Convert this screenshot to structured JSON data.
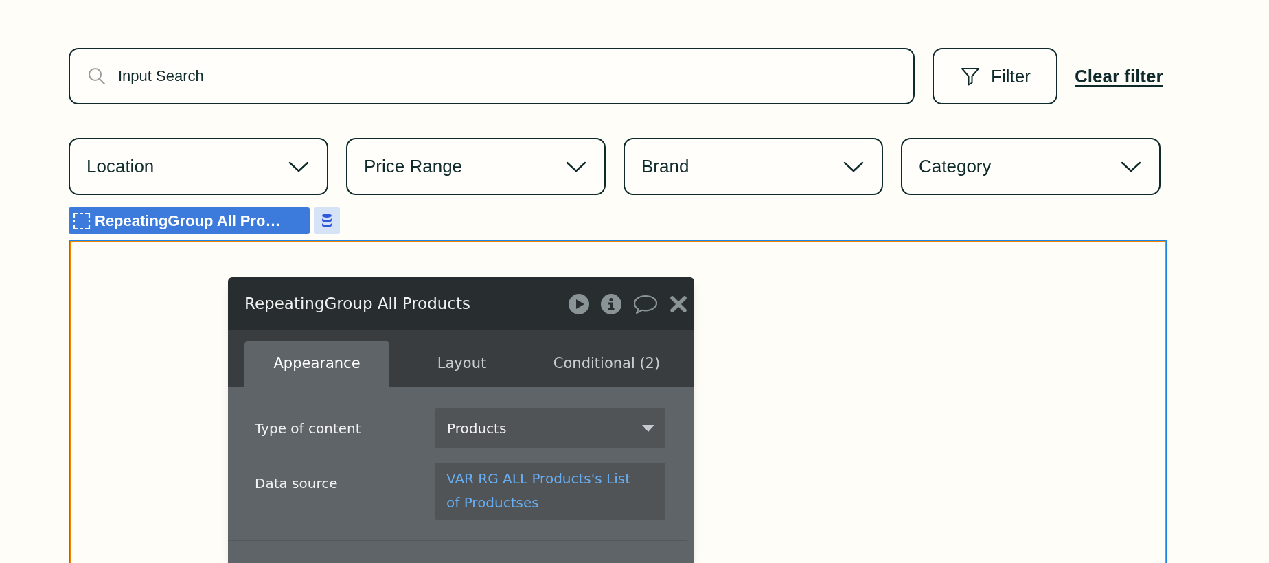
{
  "search": {
    "placeholder": "Input Search"
  },
  "filter_button": {
    "label": "Filter"
  },
  "clear_filter_link": {
    "label": "Clear filter"
  },
  "dropdowns": [
    {
      "label": "Location"
    },
    {
      "label": "Price Range"
    },
    {
      "label": "Brand"
    },
    {
      "label": "Category"
    }
  ],
  "element_tag": {
    "label": "RepeatingGroup All Pro…"
  },
  "property_editor": {
    "title": "RepeatingGroup All Products",
    "tabs": [
      {
        "label": "Appearance",
        "selected": true
      },
      {
        "label": "Layout",
        "selected": false
      },
      {
        "label": "Conditional (2)",
        "selected": false
      }
    ],
    "fields": [
      {
        "label": "Type of content",
        "kind": "dropdown",
        "value": "Products"
      },
      {
        "label": "Data source",
        "kind": "expression",
        "value": "VAR RG ALL Products's List of Productses"
      }
    ]
  }
}
